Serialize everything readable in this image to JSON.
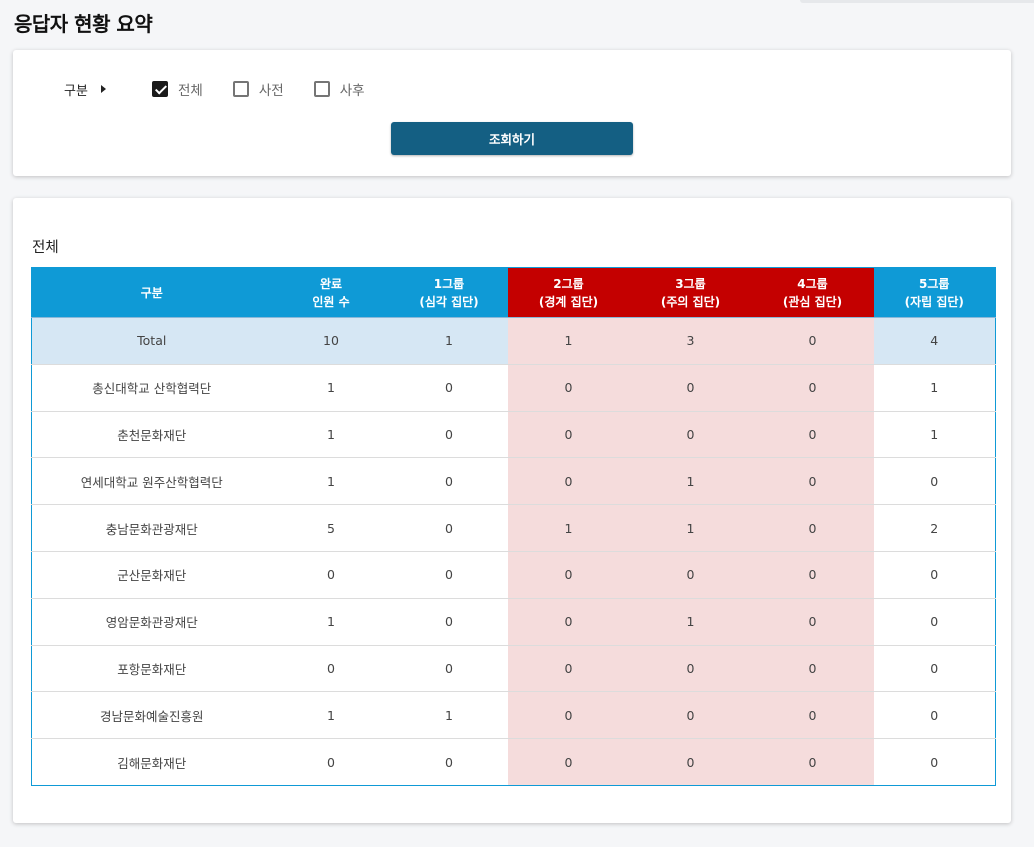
{
  "page": {
    "title": "응답자 현황 요약"
  },
  "filter": {
    "label": "구분",
    "options": [
      {
        "label": "전체",
        "checked": true
      },
      {
        "label": "사전",
        "checked": false
      },
      {
        "label": "사후",
        "checked": false
      }
    ],
    "search_label": "조회하기"
  },
  "result": {
    "section_title": "전체",
    "headers": {
      "category": "구분",
      "complete_1": "완료",
      "complete_2": "인원 수",
      "g1_1": "1그룹",
      "g1_2": "(심각 집단)",
      "g2_1": "2그룹",
      "g2_2": "(경계 집단)",
      "g3_1": "3그룹",
      "g3_2": "(주의 집단)",
      "g4_1": "4그룹",
      "g4_2": "(관심 집단)",
      "g5_1": "5그룹",
      "g5_2": "(자립 집단)"
    },
    "colors": {
      "header_blue": "#0f9ad6",
      "header_red": "#c40000",
      "button": "#145f83"
    },
    "rows": [
      {
        "name": "Total",
        "complete": "10",
        "g1": "1",
        "g2": "1",
        "g3": "3",
        "g4": "0",
        "g5": "4"
      },
      {
        "name": "총신대학교 산학협력단",
        "complete": "1",
        "g1": "0",
        "g2": "0",
        "g3": "0",
        "g4": "0",
        "g5": "1"
      },
      {
        "name": "춘천문화재단",
        "complete": "1",
        "g1": "0",
        "g2": "0",
        "g3": "0",
        "g4": "0",
        "g5": "1"
      },
      {
        "name": "연세대학교 원주산학협력단",
        "complete": "1",
        "g1": "0",
        "g2": "0",
        "g3": "1",
        "g4": "0",
        "g5": "0"
      },
      {
        "name": "충남문화관광재단",
        "complete": "5",
        "g1": "0",
        "g2": "1",
        "g3": "1",
        "g4": "0",
        "g5": "2"
      },
      {
        "name": "군산문화재단",
        "complete": "0",
        "g1": "0",
        "g2": "0",
        "g3": "0",
        "g4": "0",
        "g5": "0"
      },
      {
        "name": "영암문화관광재단",
        "complete": "1",
        "g1": "0",
        "g2": "0",
        "g3": "1",
        "g4": "0",
        "g5": "0"
      },
      {
        "name": "포항문화재단",
        "complete": "0",
        "g1": "0",
        "g2": "0",
        "g3": "0",
        "g4": "0",
        "g5": "0"
      },
      {
        "name": "경남문화예술진흥원",
        "complete": "1",
        "g1": "1",
        "g2": "0",
        "g3": "0",
        "g4": "0",
        "g5": "0"
      },
      {
        "name": "김해문화재단",
        "complete": "0",
        "g1": "0",
        "g2": "0",
        "g3": "0",
        "g4": "0",
        "g5": "0"
      }
    ]
  }
}
